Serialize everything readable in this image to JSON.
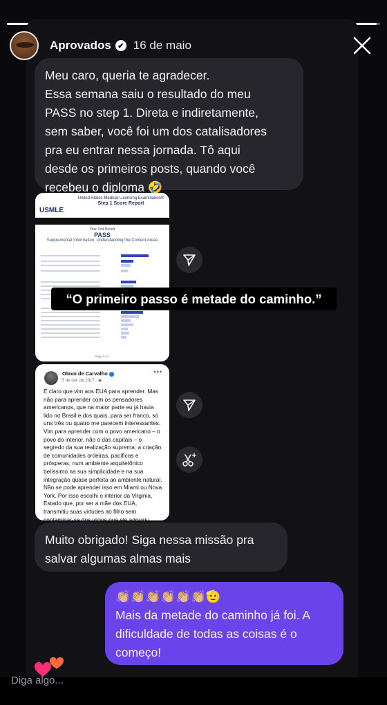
{
  "story": {
    "progress": 0.99,
    "account_name": "Aprovados",
    "verified_mark": "✔",
    "date": "16 de maio",
    "reply_placeholder": "Diga algo..."
  },
  "messages": {
    "incoming_1": "Meu caro, queria te agradecer.\nEssa semana saiu o resultado do meu\nPASS no step 1. Direta e indiretamente,\nsem saber, você foi um dos catalisadores\npra eu entrar nessa jornada. Tô aqui\ndesde os primeiros posts, quando você\nrecebeu o diploma 🤣",
    "incoming_2": "Muito obrigado! Siga nessa missão pra\nsalvar algumas almas mais",
    "outgoing_1": "👏🏼👏🏼👏🏼👏🏼👏🏼👏🏼🫡\nMais da metade do caminho já foi. A\ndificuldade de todas as coisas é o\ncomeço!"
  },
  "overlay_quote": "“O primeiro passo é metade do caminho.”",
  "usmle_report": {
    "title_line1": "United States Medical Licensing Examination®",
    "title_line2": "Step 1 Score Report",
    "logo": "USMLE",
    "your_result_label": "Your Test Result",
    "result": "PASS",
    "section_title": "Supplemental Information: Understanding the Content Areas",
    "page": "Page 1 of 1"
  },
  "fb_post": {
    "author": "Olavo de Carvalho",
    "date": "5 de out. de 2017 · ◉",
    "more": "•••",
    "text": "É claro que vim aos EUA para aprender. Mas não para aprender com os pensadores americanos, que na maior parte eu já havia lido no Brasil e dos quais, para ser franco, só uns três ou quatro me parecem interessantes. Vim para aprender com o povo americano – o povo do interior, não o das capitais – o segredo da sua realização suprema: a criação de comunidades ordeiras, pacíficas e prósperas, num ambiente arquitetônico belíssimo na sua simplicidade e na sua integração quase perfeita ao ambiente natural. Não se pode aprender isso em Miami ou Nova York. Por isso escolhi o interior da Virginia, Estado que, por ser a mãe dos EUA, transmitiu suas virtudes ao filho sem contaminar-se dos vícios que ele adquiriu depois."
  },
  "icons": {
    "close": "close-icon",
    "share_1": "share-arrow-icon",
    "share_2": "share-arrow-icon",
    "remix": "scissors-sparkle-icon",
    "like": "heart-icon"
  },
  "colors": {
    "outgoing_bubble": "#6b43ea",
    "incoming_bubble": "#26262c",
    "heart_pink": "#ff2d7a",
    "heart_orange": "#ff6a3d"
  }
}
